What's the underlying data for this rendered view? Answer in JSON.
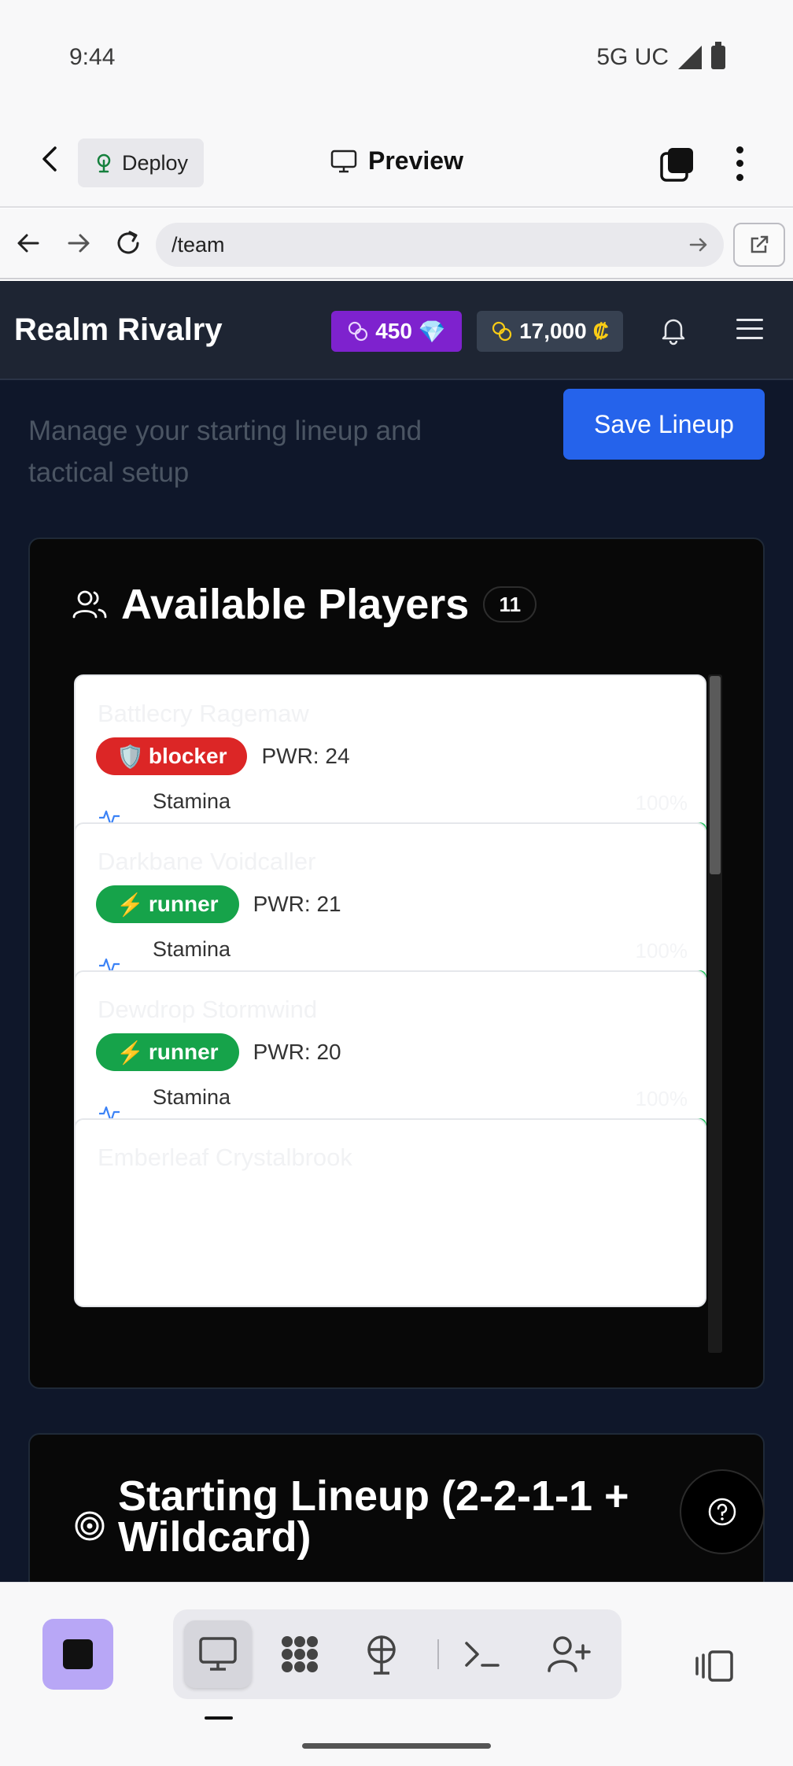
{
  "status": {
    "time": "9:44",
    "network": "5G UC"
  },
  "toolbar": {
    "deploy_label": "Deploy",
    "preview_label": "Preview"
  },
  "browser": {
    "url": "/team"
  },
  "app": {
    "brand": "Realm Rivalry",
    "gems": "450",
    "gems_symbol": "💎",
    "coins": "17,000",
    "coins_symbol": "₡",
    "subtitle": "Manage your starting lineup and tactical setup",
    "save_label": "Save Lineup",
    "available": {
      "title": "Available Players",
      "count": "11",
      "players": [
        {
          "name": "Battlecry Ragemaw",
          "role_icon": "🛡️",
          "role": "blocker",
          "power": "PWR: 24",
          "stamina_label": "Stamina",
          "stamina_pct": "100%",
          "stamina": 1.0
        },
        {
          "name": "Darkbane Voidcaller",
          "role_icon": "⚡",
          "role": "runner",
          "power": "PWR: 21",
          "stamina_label": "Stamina",
          "stamina_pct": "100%",
          "stamina": 1.0
        },
        {
          "name": "Dewdrop Stormwind",
          "role_icon": "⚡",
          "role": "runner",
          "power": "PWR: 20",
          "stamina_label": "Stamina",
          "stamina_pct": "100%",
          "stamina": 1.0
        },
        {
          "name": "Emberleaf Crystalbrook"
        }
      ]
    },
    "lineup": {
      "title": "Starting Lineup (2-2-1-1 + Wildcard)"
    }
  }
}
